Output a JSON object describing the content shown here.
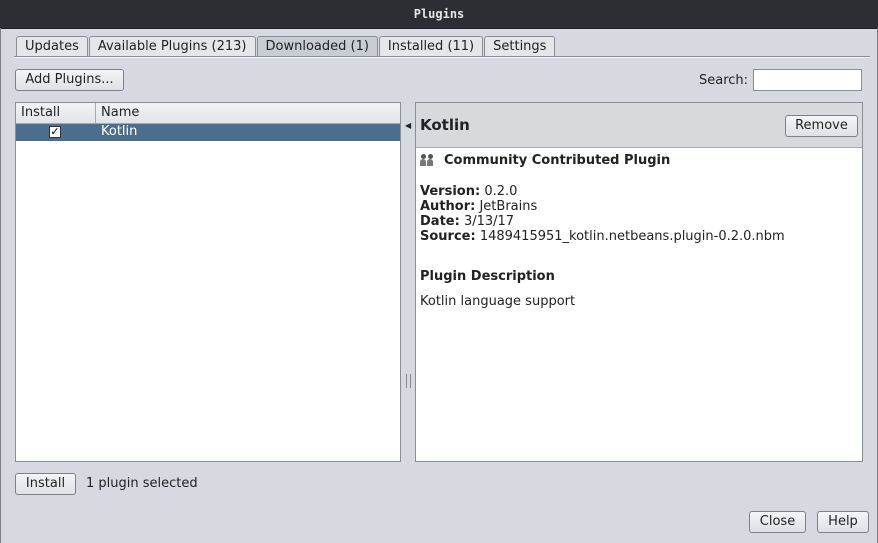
{
  "window": {
    "title": "Plugins"
  },
  "tabs": [
    {
      "label": "Updates"
    },
    {
      "label": "Available Plugins (213)"
    },
    {
      "label": "Downloaded (1)"
    },
    {
      "label": "Installed (11)"
    },
    {
      "label": "Settings"
    }
  ],
  "toolbar": {
    "add_plugins_label": "Add Plugins...",
    "search_label": "Search:",
    "search_value": ""
  },
  "table": {
    "columns": [
      "Install",
      "Name"
    ],
    "rows": [
      {
        "install": "✓",
        "name": "Kotlin"
      }
    ]
  },
  "detail": {
    "title": "Kotlin",
    "remove_label": "Remove",
    "badge": "Community Contributed Plugin",
    "version_label": "Version:",
    "version": "0.2.0",
    "author_label": "Author:",
    "author": "JetBrains",
    "date_label": "Date:",
    "date": "3/13/17",
    "source_label": "Source:",
    "source": "1489415951_kotlin.netbeans.plugin-0.2.0.nbm",
    "description_heading": "Plugin Description",
    "description": "Kotlin language support"
  },
  "footer": {
    "install_label": "Install",
    "status": "1 plugin selected",
    "close_label": "Close",
    "help_label": "Help"
  },
  "colors": {
    "selection": "#4d6d8c",
    "titlebar": "#2b2e33"
  }
}
